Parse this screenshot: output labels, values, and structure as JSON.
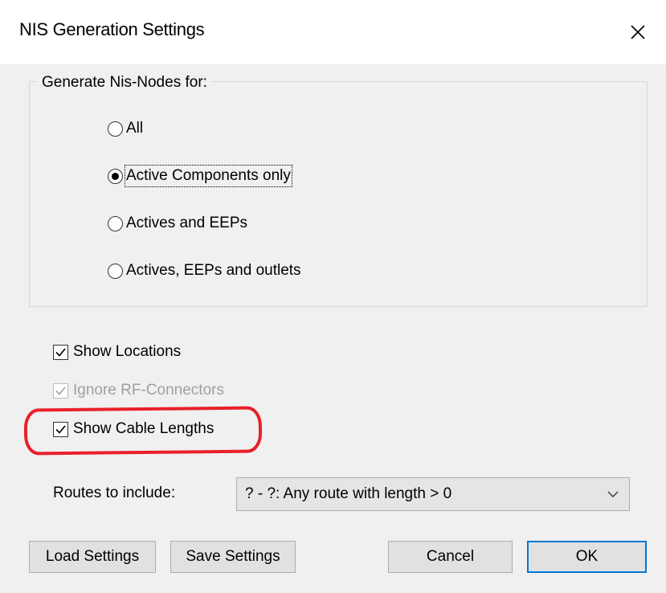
{
  "window": {
    "title": "NIS Generation Settings",
    "close_glyph": "close-icon"
  },
  "generate_group": {
    "legend": "Generate Nis-Nodes for:",
    "options": [
      {
        "label": "All",
        "selected": false
      },
      {
        "label": "Active Components only",
        "selected": true
      },
      {
        "label": "Actives and EEPs",
        "selected": false
      },
      {
        "label": "Actives, EEPs and outlets",
        "selected": false
      }
    ]
  },
  "checkboxes": {
    "show_locations": {
      "label": "Show Locations",
      "checked": true,
      "enabled": true
    },
    "ignore_rf": {
      "label": "Ignore RF-Connectors",
      "checked": true,
      "enabled": false
    },
    "show_cable_lengths": {
      "label": "Show Cable Lengths",
      "checked": true,
      "enabled": true
    }
  },
  "routes": {
    "label": "Routes to include:",
    "selected": "? - ?: Any route with length > 0"
  },
  "buttons": {
    "load": "Load Settings",
    "save": "Save Settings",
    "cancel": "Cancel",
    "ok": "OK"
  },
  "colors": {
    "highlight": "#e8202a",
    "default_button_border": "#0078d7",
    "dialog_bg": "#f0f0f0"
  }
}
